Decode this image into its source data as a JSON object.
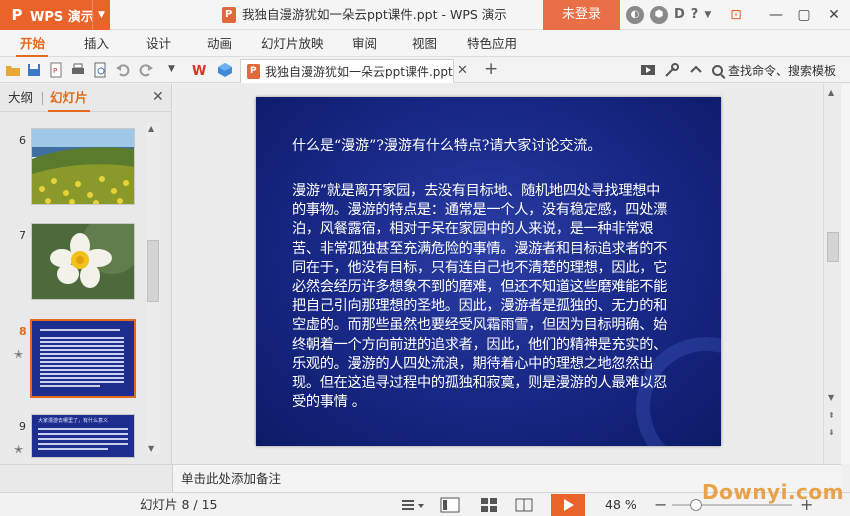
{
  "app": {
    "name": "WPS 演示",
    "logo_letter": "P"
  },
  "window": {
    "title": "我独自漫游犹如一朵云ppt课件.ppt - WPS 演示"
  },
  "account": {
    "login_label": "未登录"
  },
  "title_icons": {
    "help": "?",
    "d_label": "D"
  },
  "ribbon": {
    "tabs": [
      "开始",
      "插入",
      "设计",
      "动画",
      "幻灯片放映",
      "审阅",
      "视图",
      "特色应用"
    ],
    "active_tab": "开始"
  },
  "toolbar": {
    "doc_tab_label": "我独自漫游犹如一朵云ppt课件.ppt",
    "search_placeholder": "查找命令、搜索模板"
  },
  "left_panel": {
    "tab_outline": "大纲",
    "tab_slides": "幻灯片",
    "active_tab": "幻灯片",
    "thumbnails": [
      {
        "number": "6"
      },
      {
        "number": "7"
      },
      {
        "number": "8",
        "active": true,
        "starred": true
      },
      {
        "number": "9",
        "starred": true,
        "caption": "大家漫游去哪里了，有什么意义"
      }
    ],
    "add_label": "+"
  },
  "slide": {
    "question": "什么是“漫游”?漫游有什么特点?请大家讨论交流。",
    "body": "漫游”就是离开家园，去没有目标地、随机地四处寻找理想中的事物。漫游的特点是：通常是一个人，没有稳定感，四处漂泊，风餐露宿，相对于呆在家园中的人来说，是一种非常艰苦、非常孤独甚至充满危险的事情。漫游者和目标追求者的不同在于，他没有目标，只有连自己也不清楚的理想，因此，它必然会经历许多想象不到的磨难，但还不知道这些磨难能不能把自己引向那理想的圣地。因此，漫游者是孤独的、无力的和空虚的。而那些虽然也要经受风霜雨雪，但因为目标明确、始终朝着一个方向前进的追求者，因此，他们的精神是充实的、乐观的。漫游的人四处流浪，期待着心中的理想之地忽然出现。但在这追寻过程中的孤独和寂寞，则是漫游的人最难以忍受的事情 。"
  },
  "notes": {
    "placeholder": "单击此处添加备注"
  },
  "status": {
    "slide_indicator": "幻灯片 8 / 15",
    "zoom_percent": "48 %",
    "zoom_level": 0.2
  },
  "watermark": {
    "text": "Downyi.com"
  },
  "colors": {
    "accent": "#e2691e",
    "wps_orange": "#e9632b",
    "slide_bg": "#1a2a8a"
  }
}
